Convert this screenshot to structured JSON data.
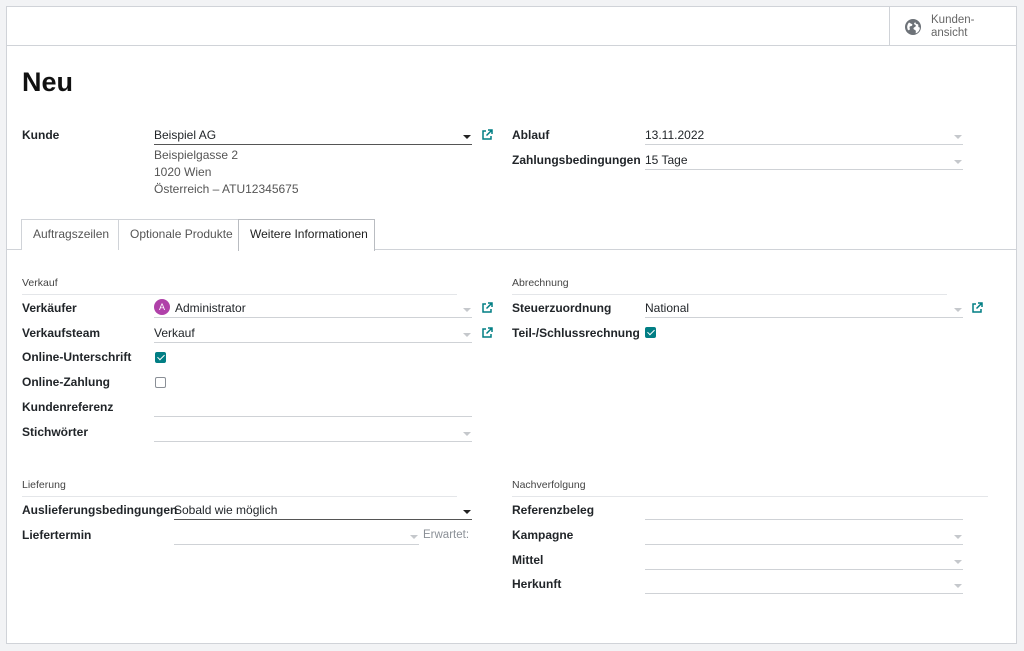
{
  "topbar": {
    "customer_view_label": "Kunden-\nansicht"
  },
  "page_title": "Neu",
  "header": {
    "customer_label": "Kunde",
    "customer_value": "Beispiel AG",
    "address_line1": "Beispielgasse 2",
    "address_line2": "1020 Wien",
    "address_line3": "Österreich – ATU12345675",
    "expiry_label": "Ablauf",
    "expiry_value": "13.11.2022",
    "payment_terms_label": "Zahlungsbedingungen",
    "payment_terms_value": "15 Tage"
  },
  "tabs": [
    {
      "label": "Auftragszeilen"
    },
    {
      "label": "Optionale Produkte"
    },
    {
      "label": "Weitere Informationen",
      "active": true
    }
  ],
  "sales": {
    "section": "Verkauf",
    "salesperson_label": "Verkäufer",
    "salesperson_value": "Administrator",
    "salesperson_initial": "A",
    "salesteam_label": "Verkaufsteam",
    "salesteam_value": "Verkauf",
    "online_signature_label": "Online-Unterschrift",
    "online_signature_checked": true,
    "online_payment_label": "Online-Zahlung",
    "online_payment_checked": false,
    "customer_reference_label": "Kundenreferenz",
    "customer_reference_value": "",
    "tags_label": "Stichwörter",
    "tags_value": ""
  },
  "invoicing": {
    "section": "Abrechnung",
    "fiscal_position_label": "Steuerzuordnung",
    "fiscal_position_value": "National",
    "partial_invoice_label": "Teil-/Schlussrechnung",
    "partial_invoice_checked": true
  },
  "delivery": {
    "section": "Lieferung",
    "shipping_policy_label": "Auslieferungsbedingungen",
    "shipping_policy_value": "Sobald wie möglich",
    "delivery_date_label": "Liefertermin",
    "delivery_date_value": "",
    "expected_label": "Erwartet:"
  },
  "tracking": {
    "section": "Nachverfolgung",
    "source_document_label": "Referenzbeleg",
    "campaign_label": "Kampagne",
    "medium_label": "Mittel",
    "source_label": "Herkunft"
  },
  "colors": {
    "accent": "#017e84",
    "avatar": "#b041a9"
  }
}
